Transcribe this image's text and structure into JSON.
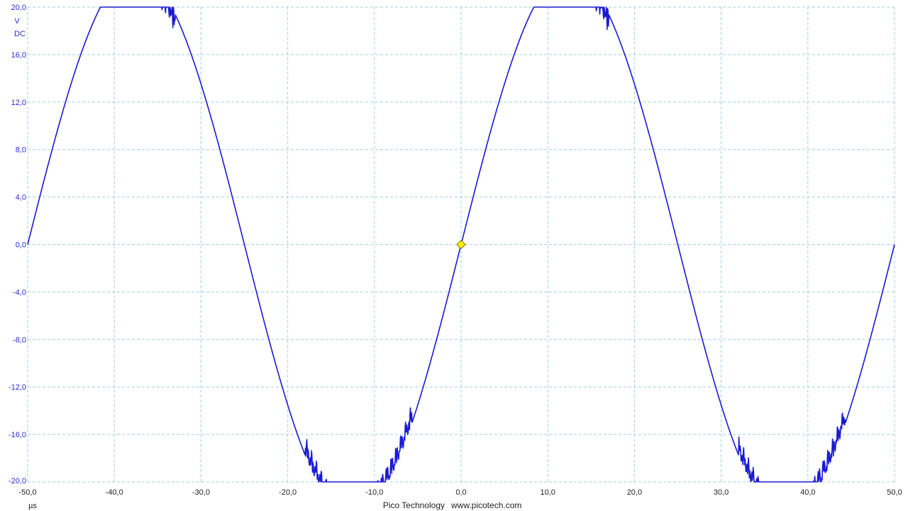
{
  "chart_data": {
    "type": "line",
    "title": "",
    "xlabel": "µs",
    "ylabel": "V",
    "coupling": "DC",
    "xlim": [
      -50,
      50
    ],
    "ylim": [
      -20,
      20
    ],
    "grid": true,
    "x_ticks": [
      "-50,0",
      "-40,0",
      "-30,0",
      "-20,0",
      "-10,0",
      "0,0",
      "10,0",
      "20,0",
      "30,0",
      "40,0",
      "50,0"
    ],
    "y_ticks": [
      "20,0",
      "16,0",
      "12,0",
      "8,0",
      "4,0",
      "0,0",
      "-4,0",
      "-8,0",
      "-12,0",
      "-16,0",
      "-20,0"
    ],
    "series": [
      {
        "color": "#1a1ad6",
        "waveform": "sine",
        "period_us": 50,
        "amplitude_v": 23,
        "clipped_at_v": [
          -20,
          20
        ],
        "x": [
          -50,
          -45,
          -40,
          -37.5,
          -35,
          -30,
          -25,
          -20,
          -15,
          -12.5,
          -10,
          -5,
          0,
          5,
          10,
          12.5,
          15,
          20,
          25,
          30,
          35,
          37.5,
          40,
          45,
          50
        ],
        "y": [
          0,
          13.5,
          20,
          20,
          20,
          13.5,
          0,
          -13.5,
          -20,
          -20,
          -20,
          -13.5,
          0,
          13.5,
          20,
          20,
          20,
          13.5,
          0,
          -13.5,
          -20,
          -20,
          -20,
          -13.5,
          0
        ]
      }
    ],
    "trigger": {
      "x": 0,
      "y": 0,
      "color": "#ffee00"
    }
  },
  "footer": {
    "brand": "Pico Technology",
    "url": "www.picotech.com"
  }
}
